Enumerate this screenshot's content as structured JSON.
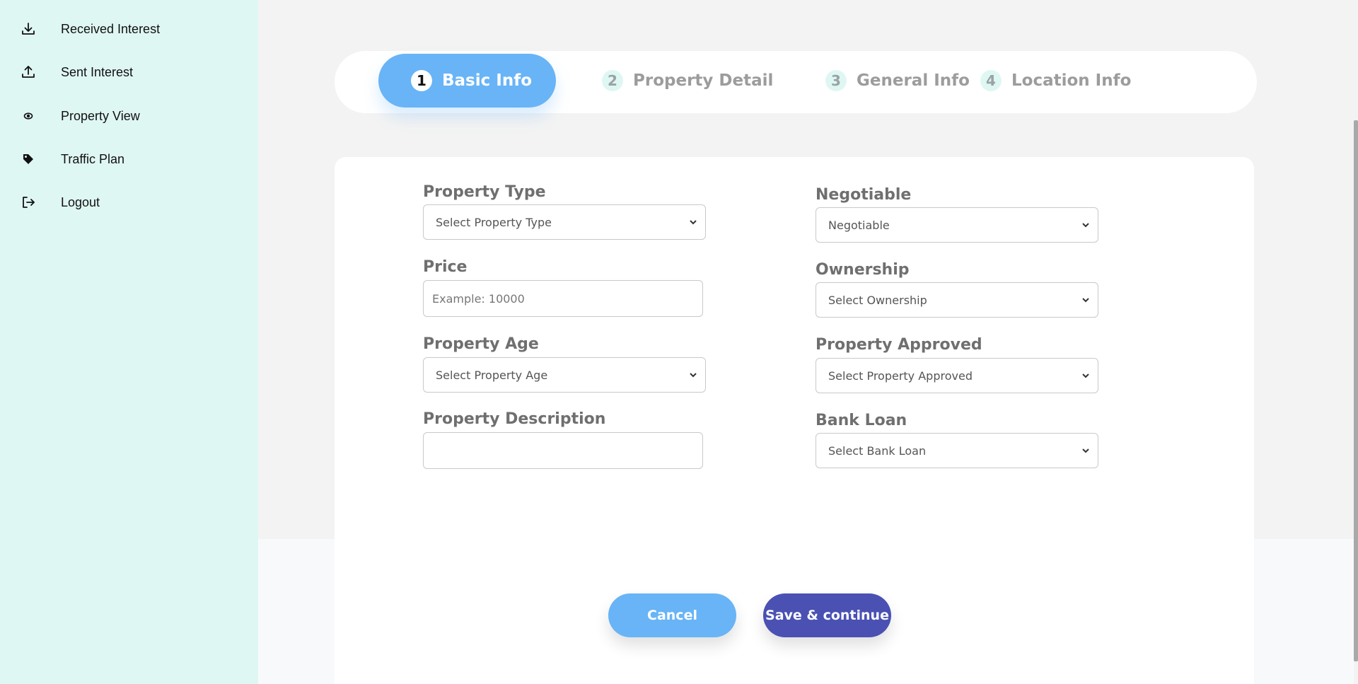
{
  "sidebar": {
    "items": [
      {
        "label": "Received Interest",
        "icon": "download-icon"
      },
      {
        "label": "Sent Interest",
        "icon": "upload-icon"
      },
      {
        "label": "Property View",
        "icon": "eye-icon"
      },
      {
        "label": "Traffic Plan",
        "icon": "tag-icon"
      },
      {
        "label": "Logout",
        "icon": "logout-icon"
      }
    ]
  },
  "stepper": {
    "steps": [
      {
        "number": "1",
        "label": "Basic Info",
        "active": true
      },
      {
        "number": "2",
        "label": "Property Detail",
        "active": false
      },
      {
        "number": "3",
        "label": "General Info",
        "active": false
      },
      {
        "number": "4",
        "label": "Location Info",
        "active": false
      }
    ]
  },
  "form": {
    "left": {
      "property_type": {
        "label": "Property Type",
        "value": "Select Property Type"
      },
      "price": {
        "label": "Price",
        "placeholder": "Example: 10000",
        "value": ""
      },
      "property_age": {
        "label": "Property Age",
        "value": "Select Property Age"
      },
      "property_description": {
        "label": "Property Description",
        "value": ""
      }
    },
    "right": {
      "negotiable": {
        "label": "Negotiable",
        "value": "Negotiable"
      },
      "ownership": {
        "label": "Ownership",
        "value": "Select Ownership"
      },
      "property_approved": {
        "label": "Property Approved",
        "value": "Select Property Approved"
      },
      "bank_loan": {
        "label": "Bank Loan",
        "value": "Select Bank Loan"
      }
    }
  },
  "actions": {
    "cancel_label": "Cancel",
    "save_label": "Save & continue"
  },
  "colors": {
    "sidebar_bg": "#dff7f3",
    "accent_blue": "#68b4f6",
    "primary_indigo": "#4a51b3"
  }
}
